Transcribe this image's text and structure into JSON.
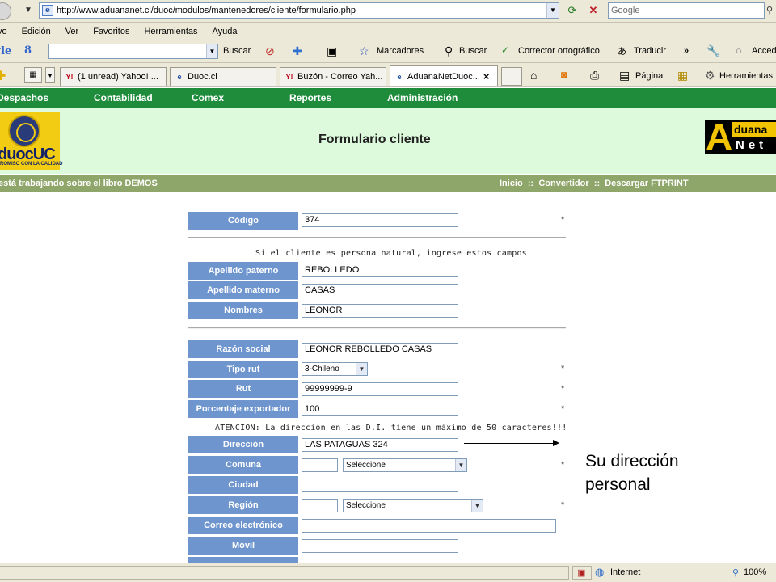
{
  "browser": {
    "address_url": "http://www.aduananet.cl/duoc/modulos/mantenedores/cliente/formulario.php",
    "search_placeholder": "Google",
    "menu": [
      "vo",
      "Edición",
      "Ver",
      "Favoritos",
      "Herramientas",
      "Ayuda"
    ],
    "google_toolbar": {
      "logo": "gle",
      "logo2": "8",
      "buscar": "Buscar",
      "marcadores": "Marcadores",
      "buscar2": "Buscar",
      "corrector": "Corrector ortográfico",
      "traducir": "Traducir",
      "more": "»",
      "acceder": "Acced"
    },
    "tabs": [
      {
        "label": "(1 unread) Yahoo! ...",
        "icon_text": "Y!",
        "icon_color": "#c0001a"
      },
      {
        "label": "Duoc.cl",
        "icon_text": "e",
        "icon_color": "#1f4ea3"
      },
      {
        "label": "Buzón - Correo Yah...",
        "icon_text": "Y!",
        "icon_color": "#c0001a"
      },
      {
        "label": "AduanaNetDuoc...",
        "icon_text": "e",
        "icon_color": "#1f4ea3"
      }
    ],
    "command_bar": {
      "pagina": "Página",
      "herramientas": "Herramientas"
    },
    "statusbar": {
      "zone": "Internet",
      "zoom": "100%"
    }
  },
  "app": {
    "nav": [
      "Despachos",
      "Contabilidad",
      "Comex",
      "Reportes",
      "Administración"
    ],
    "header": {
      "title": "Formulario cliente",
      "duoc_logo_text": "duocUC",
      "duoc_logo_sub": "ROMISO CON LA CALIDAD",
      "aduananet_A": "A",
      "aduananet_top": "duana",
      "aduananet_bottom": "Net"
    },
    "status_left": "está trabajando sobre el libro DEMOS",
    "status_right": {
      "inicio": "Inicio",
      "sep": "::",
      "convertidor": "Convertidor",
      "descargar": "Descargar FTPRINT"
    }
  },
  "form": {
    "required_mark": "*",
    "codigo": {
      "label": "Código",
      "value": "374"
    },
    "natural_note": "Si el cliente es persona natural, ingrese estos campos",
    "apellido_paterno": {
      "label": "Apellido paterno",
      "value": "REBOLLEDO"
    },
    "apellido_materno": {
      "label": "Apellido materno",
      "value": "CASAS"
    },
    "nombres": {
      "label": "Nombres",
      "value": "LEONOR"
    },
    "razon_social": {
      "label": "Razón social",
      "value": "LEONOR  REBOLLEDO CASAS"
    },
    "tipo_rut": {
      "label": "Tipo rut",
      "value": "3-Chileno"
    },
    "rut": {
      "label": "Rut",
      "value": "99999999-9"
    },
    "porcentaje": {
      "label": "Porcentaje exportador",
      "value": "100"
    },
    "direccion_note": "ATENCION: La dirección en las D.I. tiene un máximo de 50 caracteres!!!",
    "direccion": {
      "label": "Dirección",
      "value": "LAS PATAGUAS 324"
    },
    "comuna": {
      "label": "Comuna",
      "code": "",
      "select": "Seleccione"
    },
    "ciudad": {
      "label": "Ciudad",
      "value": ""
    },
    "region": {
      "label": "Región",
      "code": "",
      "select": "Seleccione"
    },
    "correo": {
      "label": "Correo electrónico",
      "value": ""
    },
    "movil": {
      "label": "Móvil",
      "value": ""
    }
  },
  "annotation": {
    "callout": "Su dirección personal"
  }
}
